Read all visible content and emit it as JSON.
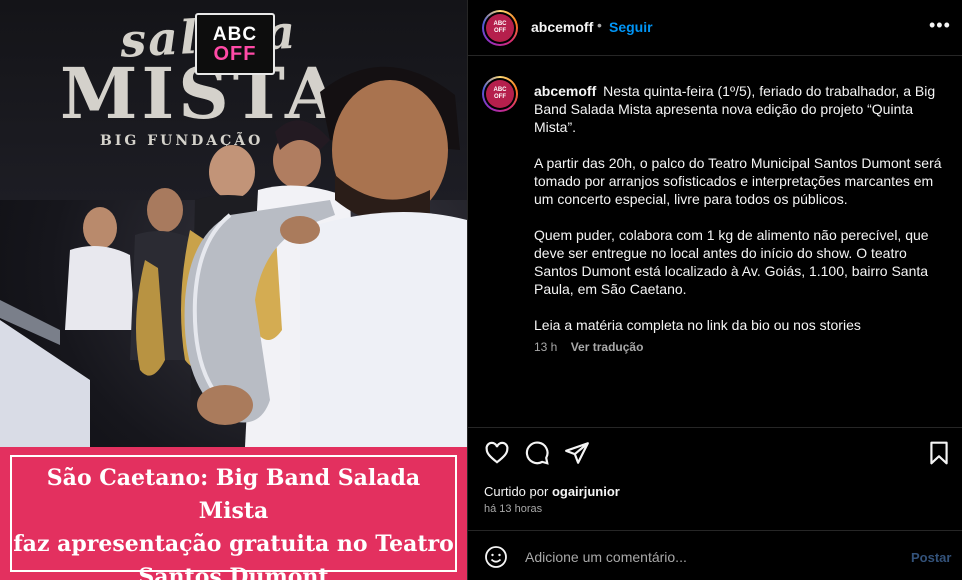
{
  "media": {
    "logo_line1": "ABC",
    "logo_line2": "OFF",
    "banner_line1": "salada",
    "banner_line2": "MISTA",
    "banner_line3": "BIG FUNDAÇÃO",
    "caption_lines": [
      "São Caetano: Big Band Salada Mista",
      "faz apresentação gratuita no Teatro",
      "Santos Dumont"
    ]
  },
  "header": {
    "avatar_text1": "ABC",
    "avatar_text2": "OFF",
    "username": "abcemoff",
    "separator": "•",
    "follow_label": "Seguir",
    "more_label": "•••"
  },
  "caption": {
    "username": "abcemoff",
    "paragraphs": [
      "Nesta quinta-feira (1º/5), feriado do trabalhador, a Big Band Salada Mista apresenta nova edição do projeto “Quinta Mista”.",
      "A partir das 20h, o palco do Teatro Municipal Santos Dumont será tomado por arranjos sofisticados e interpretações marcantes em um concerto especial, livre para todos os públicos.",
      "Quem puder, colabora com 1 kg de alimento não perecível, que deve ser entregue no local antes do início do show. O teatro Santos Dumont está localizado à Av. Goiás, 1.100, bairro Santa Paula, em São Caetano.",
      "Leia a matéria completa no link da bio ou nos stories"
    ],
    "age": "13 h",
    "translate_label": "Ver tradução"
  },
  "actions": {
    "icons": [
      "heart-icon",
      "comment-icon",
      "share-icon",
      "bookmark-icon"
    ]
  },
  "likes": {
    "prefix": "Curtido por",
    "user": "ogairjunior",
    "time": "há 13 horas"
  },
  "add_comment": {
    "placeholder": "Adicione um comentário...",
    "post_label": "Postar"
  },
  "colors": {
    "caption_bg": "#e3305f",
    "follow": "#0095f6",
    "post_disabled": "#33527a"
  }
}
